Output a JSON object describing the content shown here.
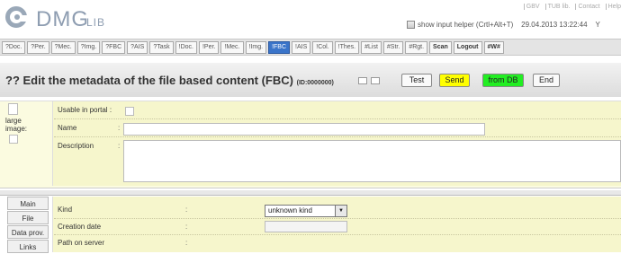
{
  "app": {
    "logo_main": "DMG",
    "logo_sub": "LIB"
  },
  "top_links": [
    "GBV",
    "TUB lib.",
    "Contact",
    "Help"
  ],
  "header": {
    "helper_label": "show input helper (Crtl+Alt+T)",
    "datetime": "29.04.2013 13:22:44",
    "datetime_suffix": "Y"
  },
  "tabs": [
    {
      "label": "?Doc."
    },
    {
      "label": "?Per."
    },
    {
      "label": "?Mec."
    },
    {
      "label": "?Img."
    },
    {
      "label": "?FBC"
    },
    {
      "label": "?AIS"
    },
    {
      "label": "?Task"
    },
    {
      "label": "!Doc."
    },
    {
      "label": "!Per."
    },
    {
      "label": "!Mec."
    },
    {
      "label": "!Img."
    },
    {
      "label": "!FBC"
    },
    {
      "label": "!AIS"
    },
    {
      "label": "!Col."
    },
    {
      "label": "!Thes."
    },
    {
      "label": "#List"
    },
    {
      "label": "#Str."
    },
    {
      "label": "#Rgt."
    },
    {
      "label": "Scan"
    },
    {
      "label": "Logout"
    },
    {
      "label": "#W#"
    }
  ],
  "title": {
    "icon": "??",
    "text": "Edit the metadata of the file based content (FBC)",
    "id": "(ID:0000000)"
  },
  "buttons": {
    "test": "Test",
    "send": "Send",
    "from_db": "from DB",
    "end": "End"
  },
  "colors": {
    "send_bg": "#ffff00",
    "from_db_bg": "#22ee22",
    "active_tab": "#3a74c9",
    "panel_bg": "#f6f6cc"
  },
  "left_panel": {
    "label_large": "large",
    "label_image": "image:"
  },
  "form": {
    "usable_in_portal": "Usable in portal",
    "name": "Name",
    "name_value": "",
    "description": "Description",
    "description_value": ""
  },
  "side_tabs": [
    "Main",
    "File",
    "Data prov.",
    "Links"
  ],
  "lower": {
    "kind_label": "Kind",
    "kind_value": "unknown kind",
    "creation_date_label": "Creation date",
    "creation_date_value": "",
    "path_label": "Path on server"
  }
}
